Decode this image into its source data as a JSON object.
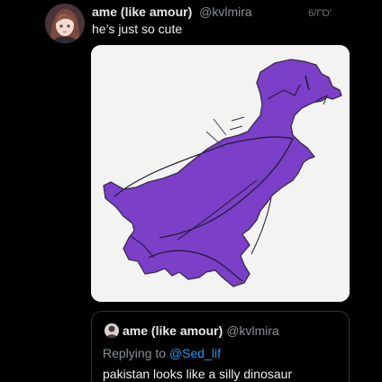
{
  "tweet": {
    "display_name": "ame (like amour)",
    "handle": "@kvlmira",
    "timestamp": "6/ΓΌ'",
    "text": "he’s just so cute",
    "avatar_icon": "anime-avatar-icon",
    "media_icon": "dinosaur-map-image"
  },
  "quote": {
    "display_name": "ame (like amour)",
    "handle": "@kvlmira",
    "replying_prefix": "Replying to",
    "replying_mention": "@Sed_lif",
    "text": "pakistan looks like a silly dinosaur",
    "avatar_icon": "small-avatar-icon"
  },
  "colors": {
    "background": "#000000",
    "text": "#e7e9ea",
    "secondary_text": "#8b8f94",
    "mention": "#1d9bf0",
    "map_fill": "#7b3fc8"
  }
}
